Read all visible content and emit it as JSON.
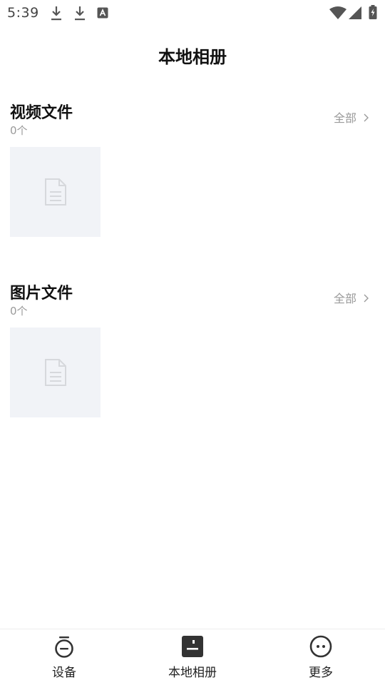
{
  "status_bar": {
    "time": "5:39",
    "left_icons": [
      "download-icon",
      "download-icon",
      "keyboard-a-icon"
    ],
    "right_icons": [
      "wifi-icon",
      "signal-icon",
      "battery-charging-icon"
    ]
  },
  "header": {
    "title": "本地相册"
  },
  "sections": [
    {
      "title": "视频文件",
      "count": "0个",
      "see_all": "全部"
    },
    {
      "title": "图片文件",
      "count": "0个",
      "see_all": "全部"
    }
  ],
  "bottom_nav": {
    "items": [
      {
        "label": "设备",
        "icon": "device-icon"
      },
      {
        "label": "本地相册",
        "icon": "album-icon"
      },
      {
        "label": "更多",
        "icon": "more-icon"
      }
    ]
  },
  "colors": {
    "placeholder_bg": "#f1f3f7",
    "muted_text": "#9a9a9a",
    "primary_text": "#111111"
  }
}
